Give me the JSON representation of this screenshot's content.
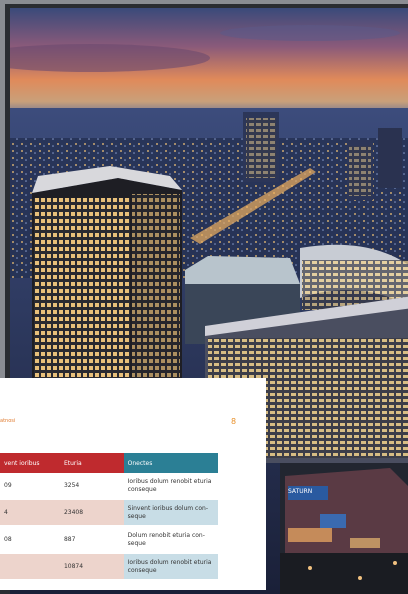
{
  "page": {
    "header_fragment": "atnosi",
    "page_number": "8"
  },
  "table": {
    "headers": [
      "vent ioribus",
      "Eturia",
      "Onectes"
    ],
    "rows": [
      [
        "09",
        "3254",
        "Ioribus dolum renobit eturia conseque"
      ],
      [
        "4",
        "23408",
        "Sinvent ioribus dolum con-seque"
      ],
      [
        "08",
        "887",
        "Dolum renobit eturia con-seque"
      ],
      [
        "",
        "10874",
        "Ioribus dolum renobit eturia conseque"
      ]
    ]
  },
  "sign": {
    "store_name": "SATURN"
  }
}
